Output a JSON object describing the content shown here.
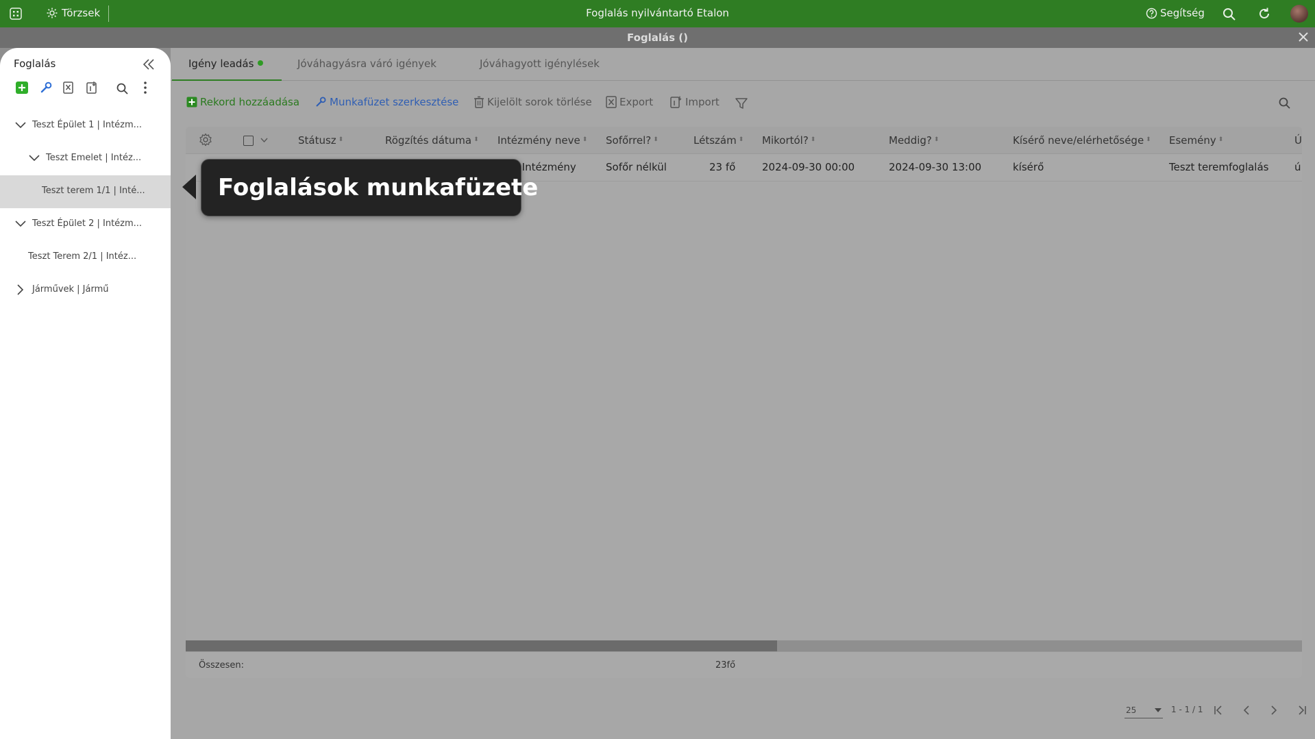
{
  "topbar": {
    "menu_label": "Törzsek",
    "app_title": "Foglalás nyilvántartó Etalon",
    "help_label": "Segítség",
    "brand_color": "#2f7d23"
  },
  "modal": {
    "title": "Foglalás ()"
  },
  "sidebar": {
    "title": "Foglalás",
    "tree": [
      {
        "label": "Teszt Épület 1 | Intézm..."
      },
      {
        "label": "Teszt Emelet | Intéz..."
      },
      {
        "label": "Teszt terem 1/1 | Inté..."
      },
      {
        "label": "Teszt Épület 2 | Intézm..."
      },
      {
        "label": "Teszt Terem 2/1 | Intéz..."
      },
      {
        "label": "Járművek | Jármű"
      }
    ]
  },
  "tabs": [
    {
      "label": "Igény leadás",
      "active": true
    },
    {
      "label": "Jóváhagyásra váró igények"
    },
    {
      "label": "Jóváhagyott igénylések"
    }
  ],
  "toolbar": {
    "add_record": "Rekord hozzáadása",
    "edit_workbook": "Munkafüzet szerkesztése",
    "delete_selected": "Kijelölt sorok törlése",
    "export": "Export",
    "import": "Import"
  },
  "grid": {
    "columns": [
      "Státusz",
      "Rögzítés dátuma",
      "Intézmény neve",
      "Sofőrrel?",
      "Létszám",
      "Mikortól?",
      "Meddig?",
      "Kísérő neve/elérhetősége",
      "Esemény",
      "Ú"
    ],
    "rows": [
      {
        "intezmeny": "t Intézmény",
        "soforrel": "Sofőr nélkül",
        "letszam": "23 fő",
        "mikortol": "2024-09-30 00:00",
        "meddig": "2024-09-30 13:00",
        "kisero": "kísérő",
        "esemeny": "Teszt teremfoglalás",
        "u": "ú"
      }
    ],
    "scroll_fraction": 0.53,
    "footer": {
      "label": "Összesen:",
      "sum": "23fő"
    }
  },
  "pager": {
    "page_size": "25",
    "range": "1 - 1 / 1"
  },
  "tooltip": {
    "text": "Foglalások munkafüzete"
  }
}
